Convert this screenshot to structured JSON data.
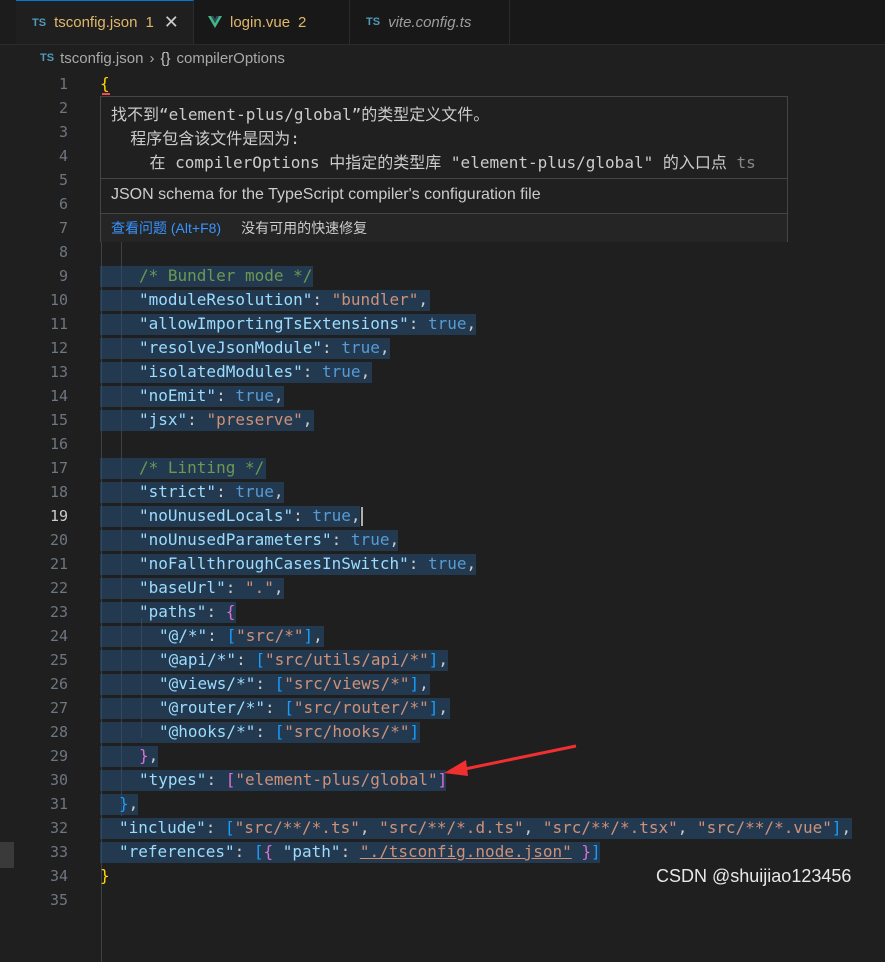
{
  "tabs": [
    {
      "icon": "TS",
      "name": "tsconfig.json",
      "badge": "1",
      "active": true
    },
    {
      "icon": "vue",
      "name": "login.vue",
      "badge": "2",
      "active": false
    },
    {
      "icon": "TS",
      "name": "vite.config.ts",
      "badge": "",
      "active": false
    }
  ],
  "breadcrumb": {
    "file": "tsconfig.json",
    "symbol": "compilerOptions",
    "ts_icon": "TS"
  },
  "hover": {
    "line1": "找不到“element-plus/global”的类型定义文件。",
    "line2": "  程序包含该文件是因为:",
    "line3": "    在 compilerOptions 中指定的类型库 \"element-plus/global\" 的入口点",
    "line3_source": "ts",
    "schema": "JSON schema for the TypeScript compiler's configuration file",
    "view_problem": "查看问题 (Alt+F8)",
    "no_fix": "没有可用的快速修复"
  },
  "current_line": 19,
  "lines": [
    {
      "n": "1"
    },
    {
      "n": "2"
    },
    {
      "n": "3"
    },
    {
      "n": "4"
    },
    {
      "n": "5"
    },
    {
      "n": "6"
    },
    {
      "n": "7"
    },
    {
      "n": "8"
    },
    {
      "n": "9"
    },
    {
      "n": "10"
    },
    {
      "n": "11"
    },
    {
      "n": "12"
    },
    {
      "n": "13"
    },
    {
      "n": "14"
    },
    {
      "n": "15"
    },
    {
      "n": "16"
    },
    {
      "n": "17"
    },
    {
      "n": "18"
    },
    {
      "n": "19"
    },
    {
      "n": "20"
    },
    {
      "n": "21"
    },
    {
      "n": "22"
    },
    {
      "n": "23"
    },
    {
      "n": "24"
    },
    {
      "n": "25"
    },
    {
      "n": "26"
    },
    {
      "n": "27"
    },
    {
      "n": "28"
    },
    {
      "n": "29"
    },
    {
      "n": "30"
    },
    {
      "n": "31"
    },
    {
      "n": "32"
    },
    {
      "n": "33"
    },
    {
      "n": "34"
    },
    {
      "n": "35"
    }
  ],
  "code": {
    "l1": "{",
    "l9": "/* Bundler mode */",
    "l10_k": "\"moduleResolution\"",
    "l10_v": "\"bundler\"",
    "l11_k": "\"allowImportingTsExtensions\"",
    "l11_v": "true",
    "l12_k": "\"resolveJsonModule\"",
    "l12_v": "true",
    "l13_k": "\"isolatedModules\"",
    "l13_v": "true",
    "l14_k": "\"noEmit\"",
    "l14_v": "true",
    "l15_k": "\"jsx\"",
    "l15_v": "\"preserve\"",
    "l17": "/* Linting */",
    "l18_k": "\"strict\"",
    "l18_v": "true",
    "l19_k": "\"noUnusedLocals\"",
    "l19_v": "true",
    "l20_k": "\"noUnusedParameters\"",
    "l20_v": "true",
    "l21_k": "\"noFallthroughCasesInSwitch\"",
    "l21_v": "true",
    "l22_k": "\"baseUrl\"",
    "l22_v": "\".\"",
    "l23_k": "\"paths\"",
    "l24_k": "\"@/*\"",
    "l24_v": "\"src/*\"",
    "l25_k": "\"@api/*\"",
    "l25_v": "\"src/utils/api/*\"",
    "l26_k": "\"@views/*\"",
    "l26_v": "\"src/views/*\"",
    "l27_k": "\"@router/*\"",
    "l27_v": "\"src/router/*\"",
    "l28_k": "\"@hooks/*\"",
    "l28_v": "\"src/hooks/*\"",
    "l30_k": "\"types\"",
    "l30_v": "\"element-plus/global\"",
    "l32_k": "\"include\"",
    "l32_v1": "\"src/**/*.ts\"",
    "l32_v2": "\"src/**/*.d.ts\"",
    "l32_v3": "\"src/**/*.tsx\"",
    "l32_v4": "\"src/**/*.vue\"",
    "l33_k": "\"references\"",
    "l33_pk": "\"path\"",
    "l33_pv": "\"./tsconfig.node.json\"",
    "l34": "}"
  },
  "watermark": "CSDN @shuijiao123456"
}
